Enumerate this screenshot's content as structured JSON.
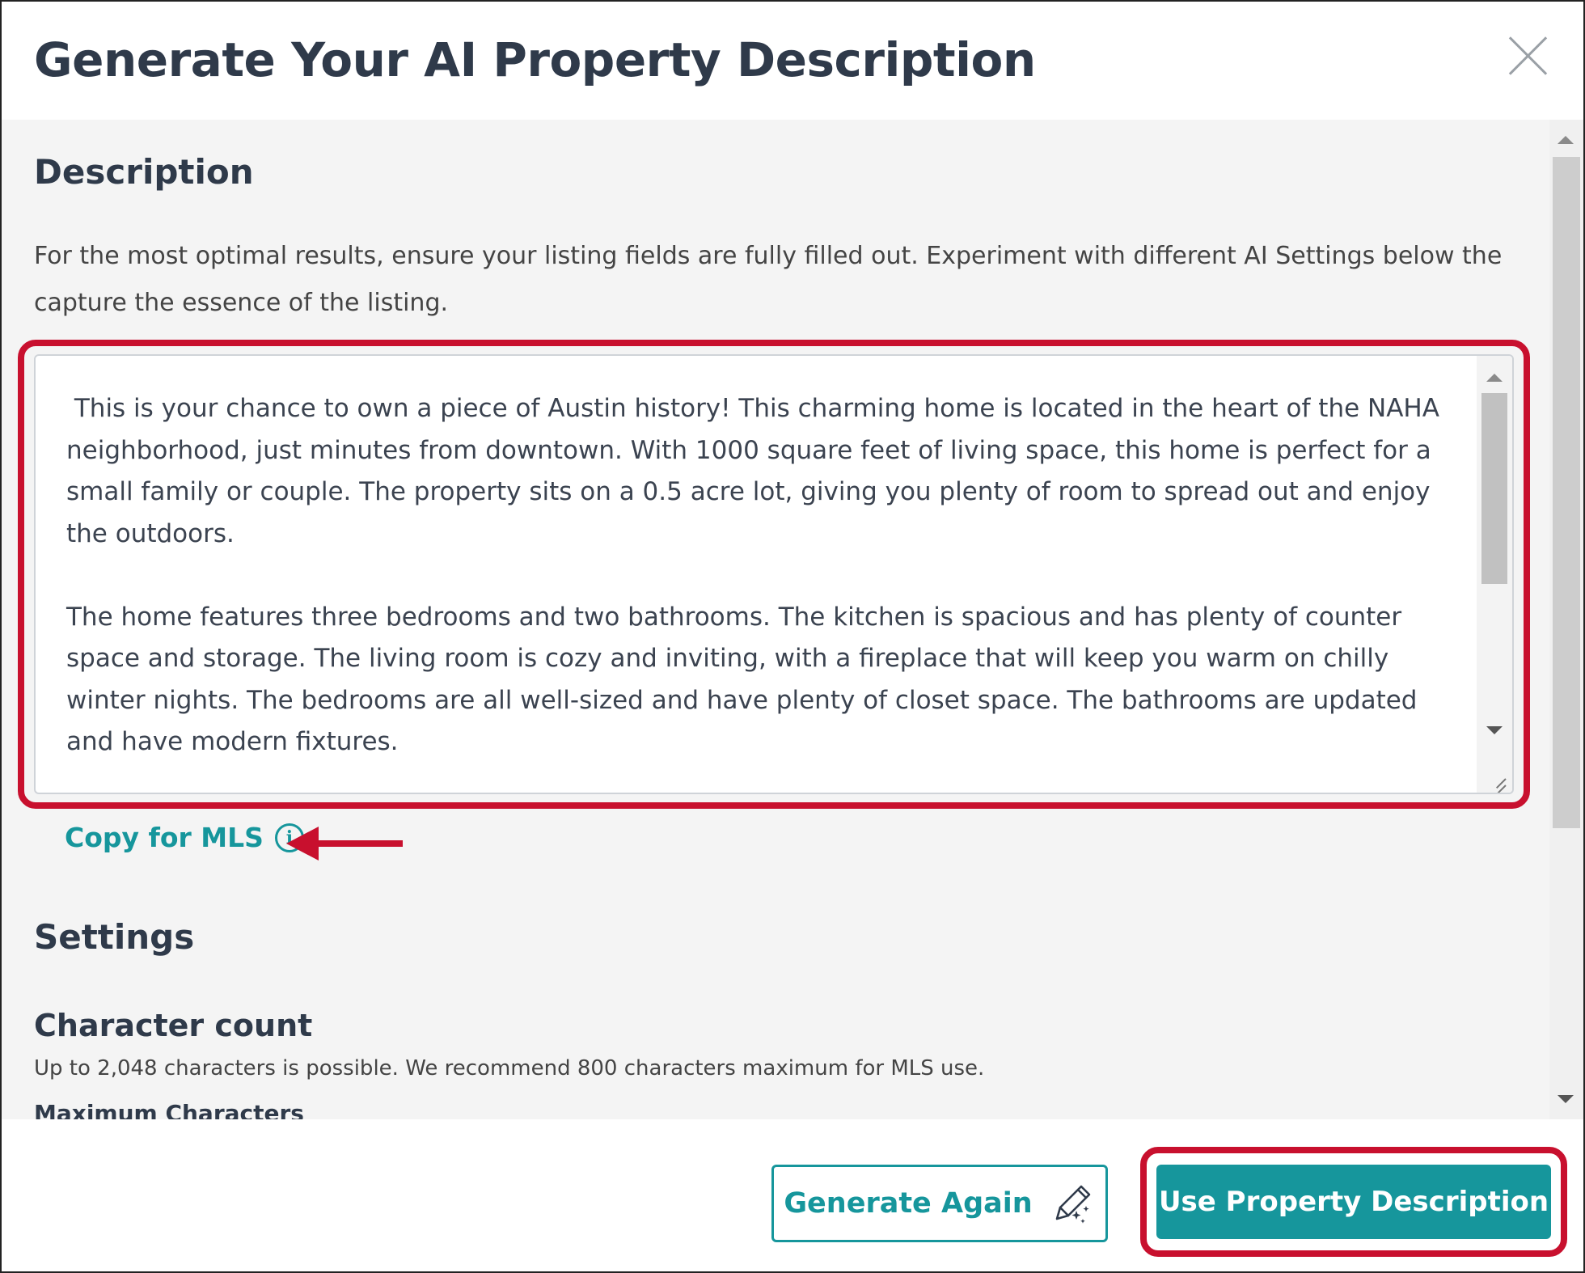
{
  "dialog": {
    "title": "Generate Your AI Property Description"
  },
  "description": {
    "heading": "Description",
    "intro": "For the most optimal results, ensure your listing fields are fully filled out. Experiment with different AI Settings below the capture the essence of the listing.",
    "text": " This is your chance to own a piece of Austin history! This charming home is located in the heart of the NAHA neighborhood, just minutes from downtown. With 1000 square feet of living space, this home is perfect for a small family or couple. The property sits on a 0.5 acre lot, giving you plenty of room to spread out and enjoy the outdoors.\n\nThe home features three bedrooms and two bathrooms. The kitchen is spacious and has plenty of counter space and storage. The living room is cozy and inviting, with a fireplace that will keep you warm on chilly winter nights. The bedrooms are all well-sized and have plenty of closet space. The bathrooms are updated and have modern fixtures.",
    "copy_label": "Copy for MLS",
    "info_glyph": "i"
  },
  "settings": {
    "heading": "Settings",
    "char_count_heading": "Character count",
    "char_count_help": "Up to 2,048 characters is possible. We recommend 800 characters maximum for MLS use.",
    "max_chars_label": "Maximum Characters"
  },
  "footer": {
    "generate_again_label": "Generate Again",
    "use_description_label": "Use Property Description"
  },
  "icons": {
    "close": "close-icon",
    "info": "info-icon",
    "pen": "magic-pen-icon",
    "arrow": "arrow-left-icon"
  },
  "colors": {
    "accent": "#16969c",
    "highlight": "#c8102e",
    "title": "#2f3a4a",
    "body_bg": "#f4f4f4"
  }
}
